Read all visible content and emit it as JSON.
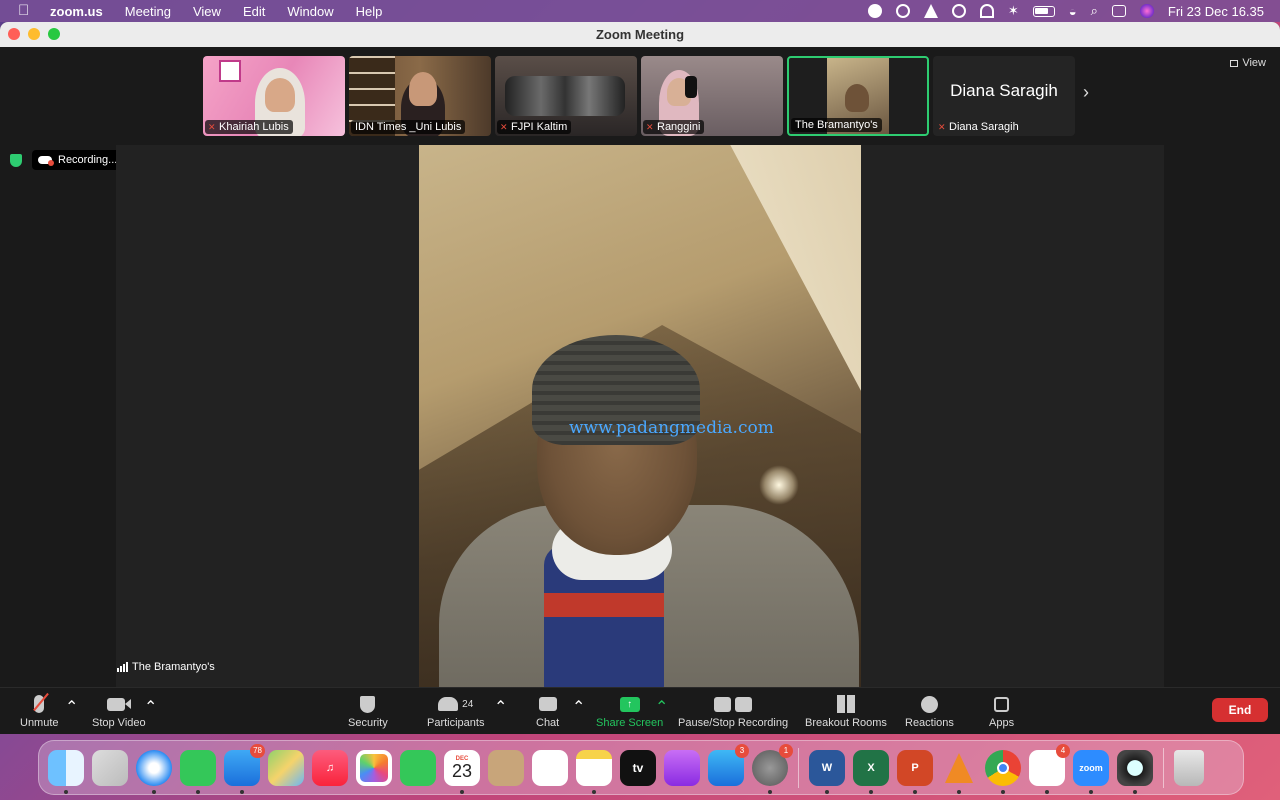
{
  "menubar": {
    "app_name": "zoom.us",
    "menus": [
      "Meeting",
      "View",
      "Edit",
      "Window",
      "Help"
    ],
    "datetime": "Fri 23 Dec  16.35"
  },
  "window": {
    "title": "Zoom Meeting"
  },
  "thumbnails": [
    {
      "name": "Khairiah Lubis",
      "muted": true
    },
    {
      "name": "IDN Times _Uni Lubis",
      "muted": false
    },
    {
      "name": "FJPI Kaltim",
      "muted": true
    },
    {
      "name": "Ranggini",
      "muted": true
    },
    {
      "name": "The Bramantyo's",
      "muted": false,
      "active": true
    },
    {
      "name": "Diana Saragih",
      "muted": true,
      "display_name": "Diana Saragih"
    }
  ],
  "view_button": "View",
  "recording": {
    "label": "Recording..."
  },
  "main_video": {
    "speaker": "The Bramantyo's",
    "watermark": "www.padangmedia.com"
  },
  "toolbar": {
    "unmute": "Unmute",
    "stop_video": "Stop Video",
    "security": "Security",
    "participants": "Participants",
    "participants_count": "24",
    "chat": "Chat",
    "share_screen": "Share Screen",
    "pause_stop_recording": "Pause/Stop Recording",
    "breakout_rooms": "Breakout Rooms",
    "reactions": "Reactions",
    "apps": "Apps",
    "end": "End"
  },
  "dock": {
    "calendar_month": "DEC",
    "calendar_day": "23",
    "tv_label": "tv",
    "zoom_label": "zoom",
    "badges": {
      "mail": "78",
      "appstore": "3",
      "settings": "1",
      "slack": "4"
    }
  },
  "colors": {
    "accent_green": "#23c55e",
    "end_red": "#d63031",
    "active_border": "#2ecc71"
  }
}
